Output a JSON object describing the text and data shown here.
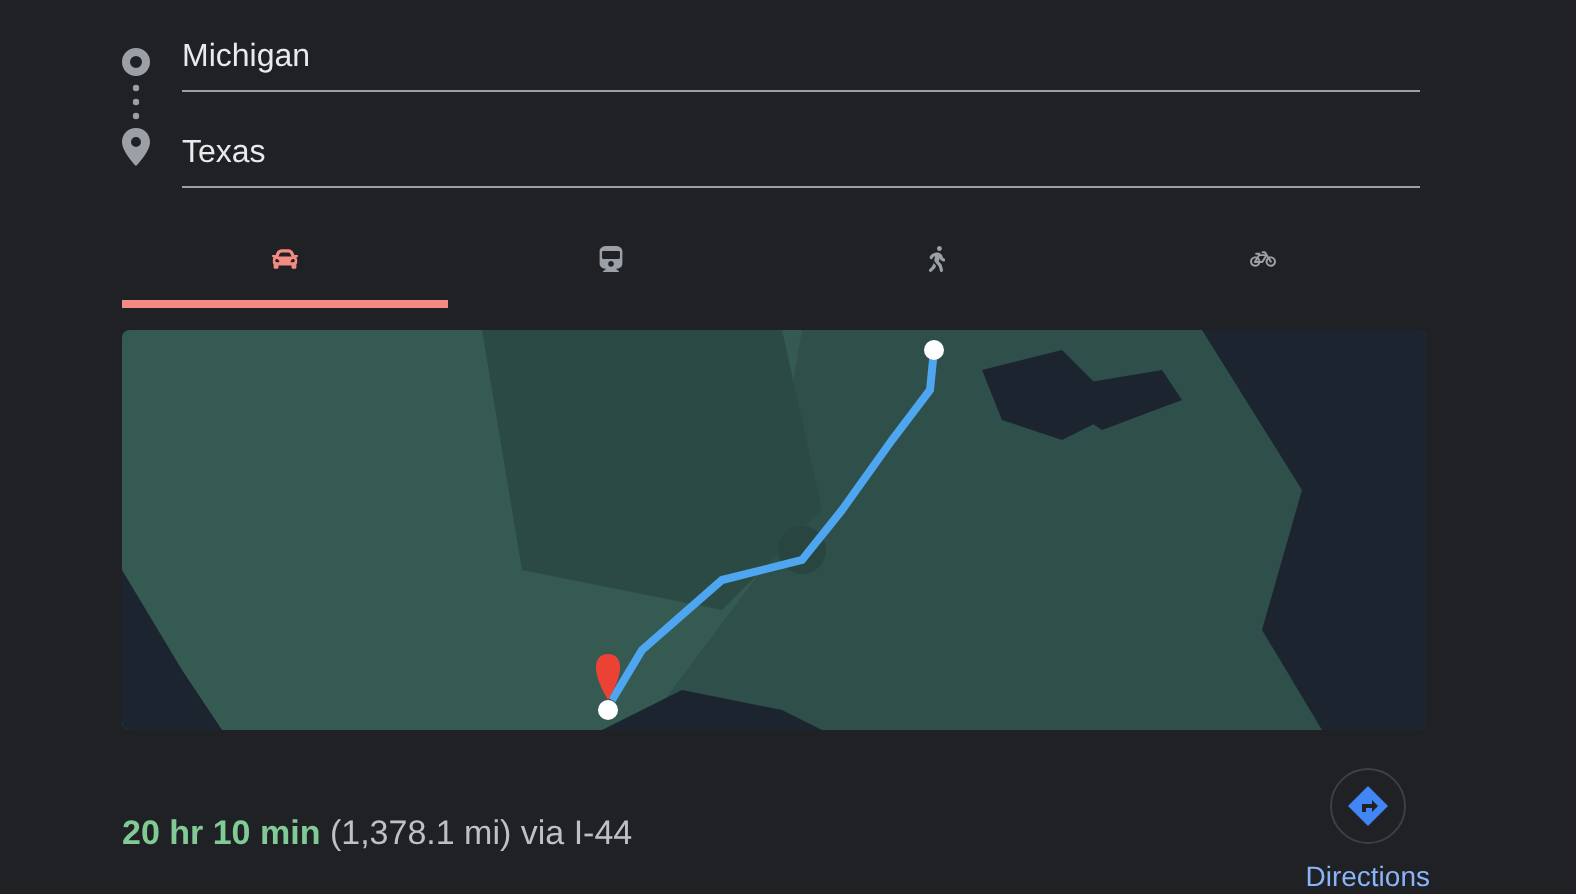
{
  "route": {
    "origin": {
      "value": "Michigan"
    },
    "destination": {
      "value": "Texas"
    }
  },
  "modes": [
    {
      "kind": "car",
      "selected": true
    },
    {
      "kind": "transit",
      "selected": false
    },
    {
      "kind": "walk",
      "selected": false
    },
    {
      "kind": "bike",
      "selected": false
    }
  ],
  "summary": {
    "duration": "20 hr 10 min",
    "details": "(1,378.1 mi) via I-44"
  },
  "directions_button": {
    "label": "Directions"
  }
}
